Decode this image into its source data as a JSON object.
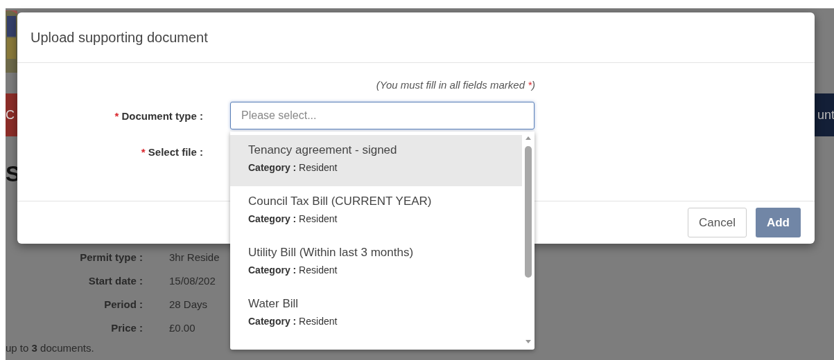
{
  "background": {
    "nav": {
      "left_text": "C",
      "right_text": "unt"
    },
    "heading": "S",
    "details": [
      {
        "label": "Permit type :",
        "value": "3hr Reside"
      },
      {
        "label": "Start date :",
        "value": "15/08/202"
      },
      {
        "label": "Period :",
        "value": "28 Days"
      },
      {
        "label": "Price :",
        "value": "£0.00"
      }
    ],
    "note": "up to **3** documents."
  },
  "dialog": {
    "title": "Upload supporting document",
    "required_note": {
      "text": "(You must fill in all fields marked",
      "mark": "*",
      "end": ")"
    },
    "fields": [
      {
        "kind": "select",
        "label": "Document type :",
        "required": true,
        "placeholder": "Please select...",
        "focused": true
      },
      {
        "kind": "file",
        "label": "Select file :",
        "required": true
      }
    ],
    "buttons": [
      {
        "kind": "secondary",
        "label": "Cancel",
        "disabled": false
      },
      {
        "kind": "primary",
        "label": "Add",
        "disabled": true
      }
    ]
  },
  "dropdown": {
    "options": [
      {
        "title": "Tenancy agreement - signed",
        "category": "**Category :** Resident",
        "selected": true
      },
      {
        "title": "Council Tax Bill (CURRENT YEAR)",
        "category": "**Category :** Resident",
        "selected": false
      },
      {
        "title": "Utility Bill (Within last 3 months)",
        "category": "**Category :** Resident",
        "selected": false
      },
      {
        "title": "Water Bill",
        "category": "**Category :** Resident",
        "selected": false
      }
    ]
  }
}
